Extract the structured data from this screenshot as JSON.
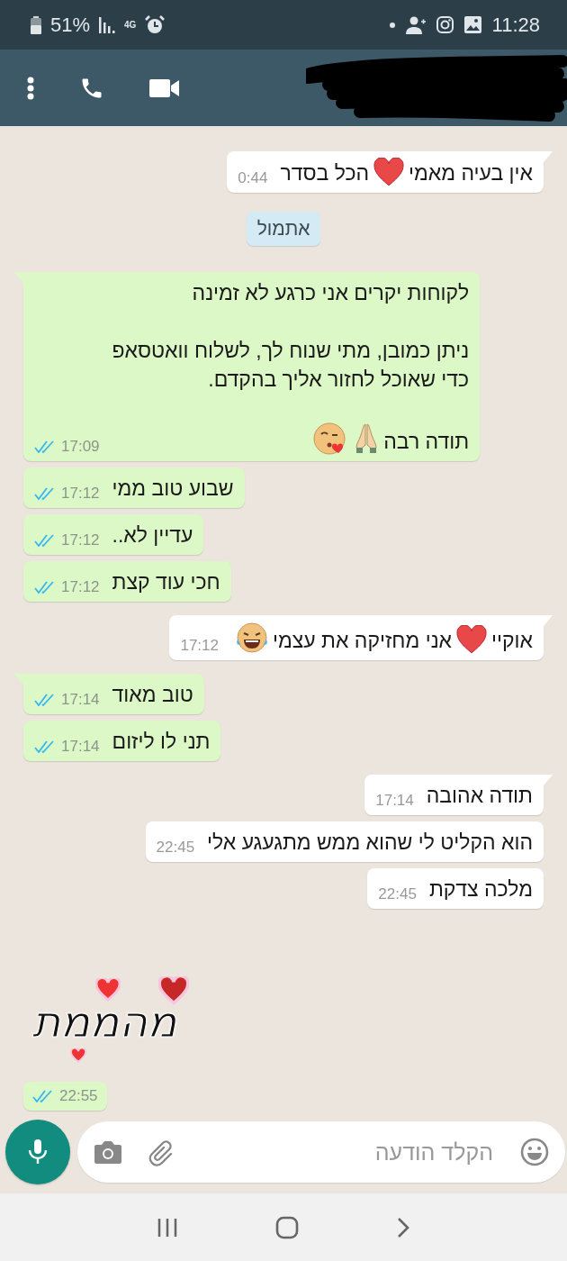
{
  "status_bar": {
    "battery": "51%",
    "network": "4G",
    "time": "11:28"
  },
  "messages": [
    {
      "kind": "received",
      "parts": [
        {
          "kind": "text",
          "text": "אין בעיה מאמי"
        },
        {
          "kind": "heart"
        },
        {
          "kind": "text",
          "text": "הכל בסדר"
        }
      ],
      "time": "0:44"
    },
    {
      "kind": "date",
      "text": "אתמול"
    },
    {
      "kind": "sent",
      "parts": [
        {
          "kind": "paragraph",
          "text": "לקוחות יקרים אני כרגע לא זמינה\n\nניתן כמובן, מתי שנוח לך, לשלוח וואטסאפ\nכדי שאוכל לחזור אליך בהקדם."
        },
        {
          "kind": "text",
          "text": "תודה רבה"
        },
        {
          "kind": "pray"
        },
        {
          "kind": "kiss"
        }
      ],
      "time": "17:09",
      "read": true
    },
    {
      "kind": "sent",
      "parts": [
        {
          "kind": "text",
          "text": "שבוע טוב ממי"
        }
      ],
      "time": "17:12",
      "read": true
    },
    {
      "kind": "sent",
      "parts": [
        {
          "kind": "text",
          "text": "עדיין לא.."
        }
      ],
      "time": "17:12",
      "read": true
    },
    {
      "kind": "sent",
      "parts": [
        {
          "kind": "text",
          "text": "חכי עוד קצת"
        }
      ],
      "time": "17:12",
      "read": true
    },
    {
      "kind": "received",
      "parts": [
        {
          "kind": "text",
          "text": "אוקיי"
        },
        {
          "kind": "heart"
        },
        {
          "kind": "text",
          "text": "אני מחזיקה את עצמי"
        },
        {
          "kind": "laugh"
        }
      ],
      "time": "17:12"
    },
    {
      "kind": "sent",
      "parts": [
        {
          "kind": "text",
          "text": "טוב מאוד"
        }
      ],
      "time": "17:14",
      "read": true
    },
    {
      "kind": "sent",
      "parts": [
        {
          "kind": "text",
          "text": "תני לו ליזום"
        }
      ],
      "time": "17:14",
      "read": true
    },
    {
      "kind": "received",
      "parts": [
        {
          "kind": "text",
          "text": "תודה אהובה"
        }
      ],
      "time": "17:14"
    },
    {
      "kind": "received",
      "parts": [
        {
          "kind": "text",
          "text": "הוא הקליט לי שהוא ממש מתגעגע אלי"
        }
      ],
      "time": "22:45"
    },
    {
      "kind": "received",
      "parts": [
        {
          "kind": "text",
          "text": "מלכה צדקת"
        }
      ],
      "time": "22:45"
    },
    {
      "kind": "sticker",
      "text": "מהממת",
      "time": "22:55",
      "read": true
    }
  ],
  "composer": {
    "placeholder": "הקלד הודעה"
  }
}
